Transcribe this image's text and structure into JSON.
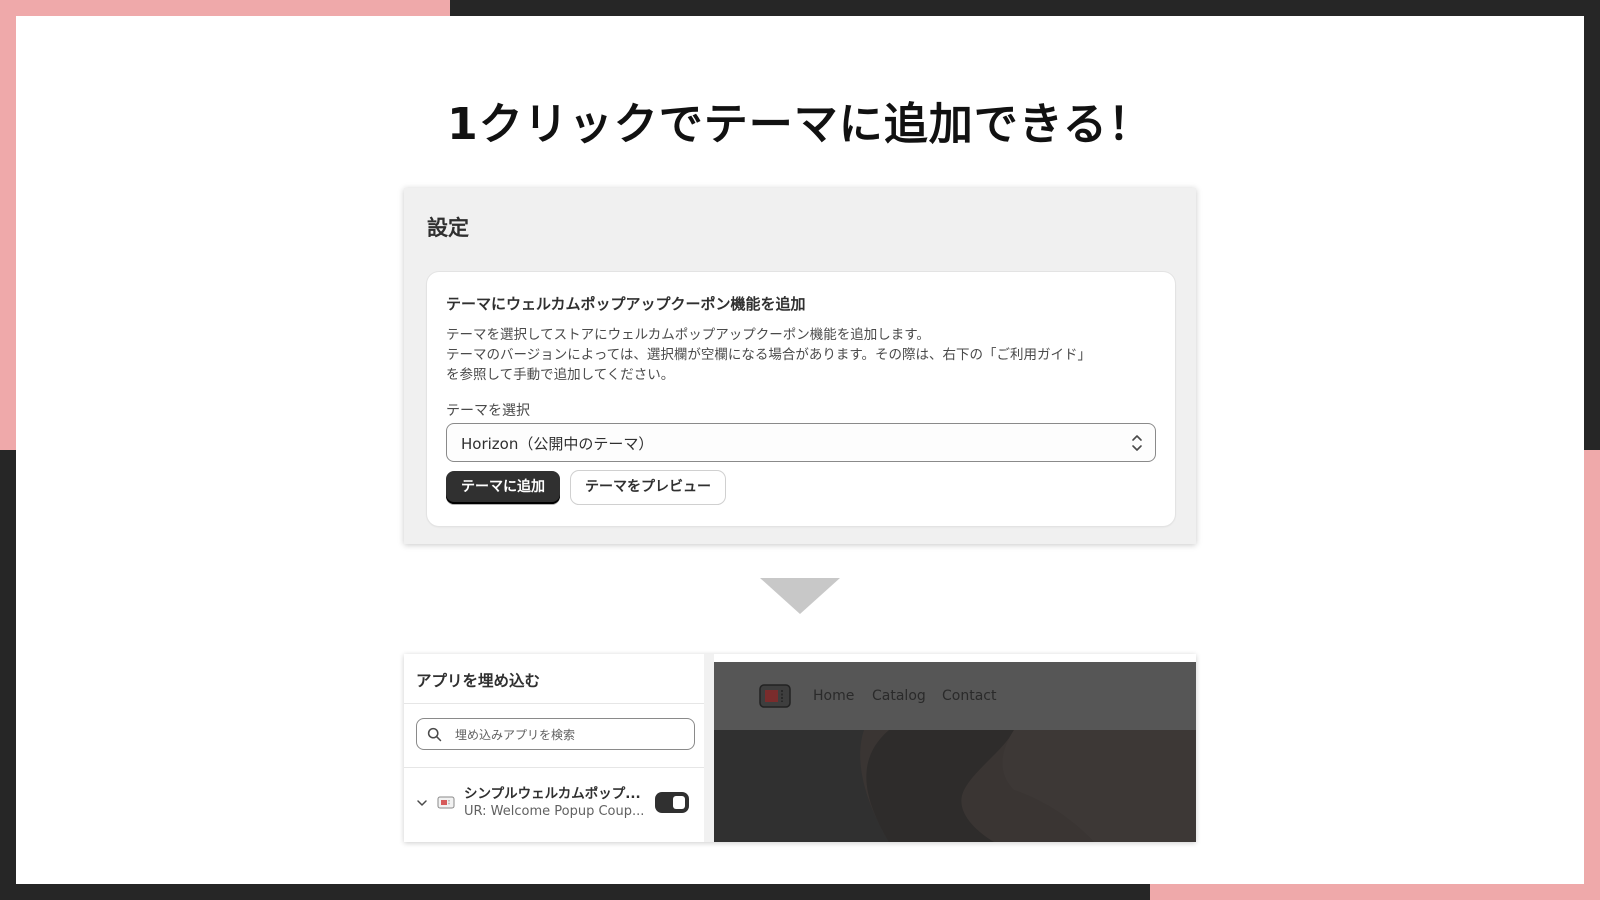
{
  "headline": "1クリックでテーマに追加できる！",
  "settings": {
    "title": "設定",
    "card_title": "テーマにウェルカムポップアップクーポン機能を追加",
    "description_lines": [
      "テーマを選択してストアにウェルカムポップアップクーポン機能を追加します。",
      "テーマのバージョンによっては、選択欄が空欄になる場合があります。その際は、右下の「ご利用ガイド」",
      "を参照して手動で追加してください。"
    ],
    "select_label": "テーマを選択",
    "selected_theme": "Horizon（公開中のテーマ）",
    "add_button": "テーマに追加",
    "preview_button": "テーマをプレビュー"
  },
  "embed": {
    "title": "アプリを埋め込む",
    "search_placeholder": "埋め込みアプリを検索",
    "app_name": "シンプルウェルカムポップ...",
    "app_handle": "UR: Welcome Popup Coup...",
    "toggle_on": true
  },
  "preview": {
    "nav": [
      "Home",
      "Catalog",
      "Contact"
    ]
  },
  "colors": {
    "frame_accent": "#efa9aa",
    "frame_dark": "#262626",
    "primary_button": "#303030"
  }
}
